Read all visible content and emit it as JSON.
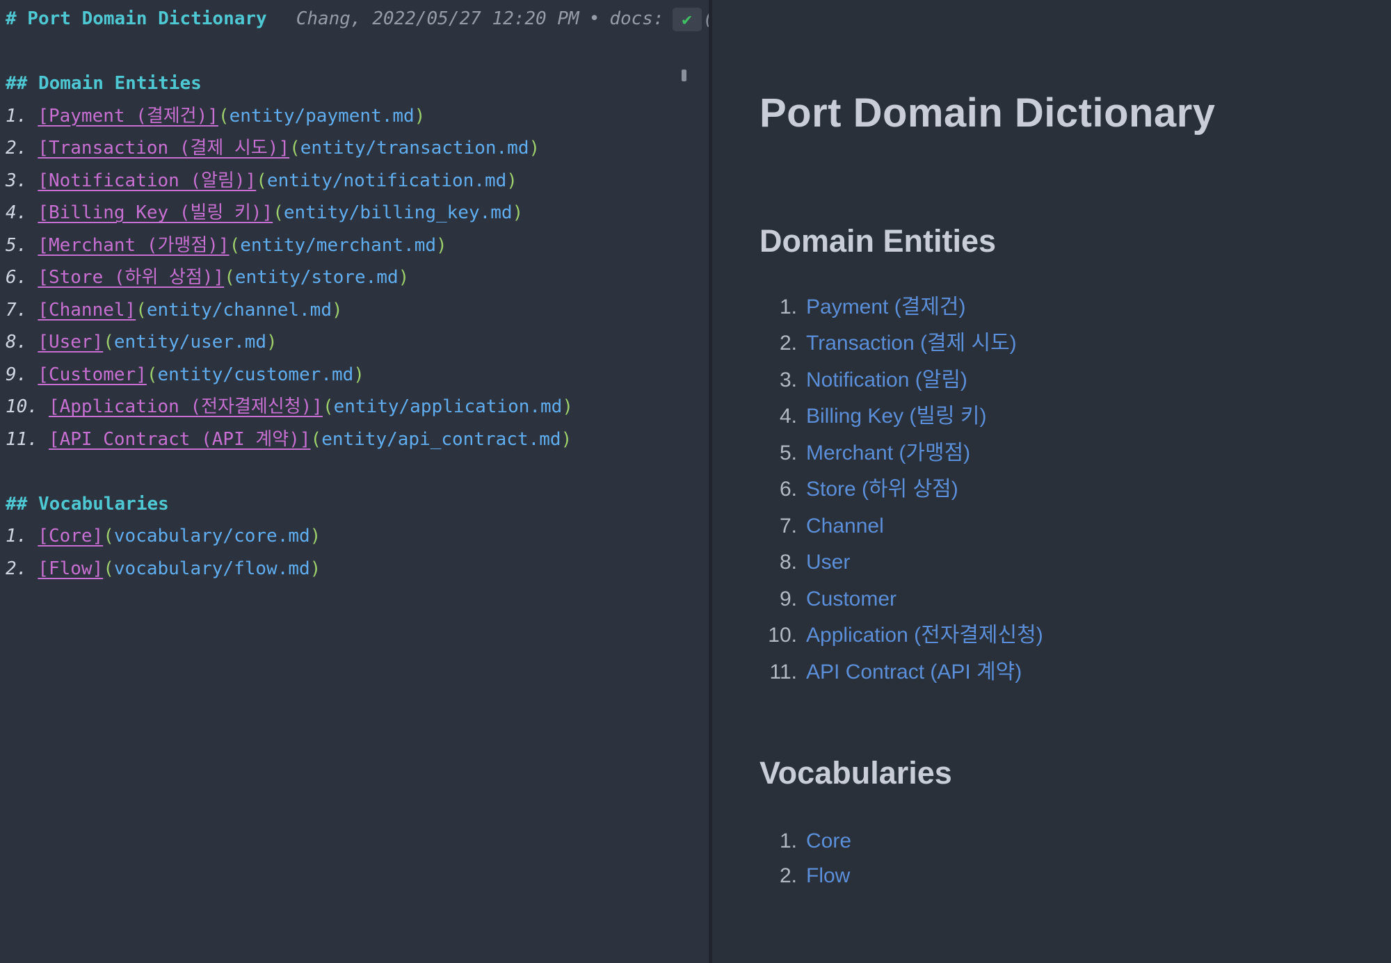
{
  "syntax": {
    "open_paren": "(",
    "close_paren": ")"
  },
  "colors": {
    "editor_background": "#2c323e",
    "preview_background": "#293039",
    "heading_cyan": "#4ec9d4",
    "link_magenta": "#c86fd2",
    "url_blue": "#60aeef",
    "paren_green": "#9ed06c",
    "preview_link_blue": "#5b8fda",
    "check_green": "#3fc163"
  },
  "editor": {
    "title_heading": "# Port Domain Dictionary",
    "blame_author_date": "Chang, 2022/05/27 12:20 PM",
    "blame_separator": "•",
    "blame_message_prefix": "docs:",
    "blame_check": "✔",
    "blame_truncated": "(",
    "entities_heading": "## Domain Entities",
    "entities": [
      {
        "num": "1.",
        "label": "[Payment (결제건)]",
        "url": "entity/payment.md"
      },
      {
        "num": "2.",
        "label": "[Transaction (결제 시도)]",
        "url": "entity/transaction.md"
      },
      {
        "num": "3.",
        "label": "[Notification (알림)]",
        "url": "entity/notification.md"
      },
      {
        "num": "4.",
        "label": "[Billing Key (빌링 키)]",
        "url": "entity/billing_key.md"
      },
      {
        "num": "5.",
        "label": "[Merchant (가맹점)]",
        "url": "entity/merchant.md"
      },
      {
        "num": "6.",
        "label": "[Store (하위 상점)]",
        "url": "entity/store.md"
      },
      {
        "num": "7.",
        "label": "[Channel]",
        "url": "entity/channel.md"
      },
      {
        "num": "8.",
        "label": "[User]",
        "url": "entity/user.md"
      },
      {
        "num": "9.",
        "label": "[Customer]",
        "url": "entity/customer.md"
      },
      {
        "num": "10.",
        "label": "[Application (전자결제신청)]",
        "url": "entity/application.md"
      },
      {
        "num": "11.",
        "label": "[API Contract (API 계약)]",
        "url": "entity/api_contract.md"
      }
    ],
    "vocab_heading": "## Vocabularies",
    "vocabularies": [
      {
        "num": "1.",
        "label": "[Core]",
        "url": "vocabulary/core.md"
      },
      {
        "num": "2.",
        "label": "[Flow]",
        "url": "vocabulary/flow.md"
      }
    ]
  },
  "preview": {
    "title": "Port Domain Dictionary",
    "entities_heading": "Domain Entities",
    "entities": [
      {
        "num": "1.",
        "text": "Payment (결제건)"
      },
      {
        "num": "2.",
        "text": "Transaction (결제 시도)"
      },
      {
        "num": "3.",
        "text": "Notification (알림)"
      },
      {
        "num": "4.",
        "text": "Billing Key (빌링 키)"
      },
      {
        "num": "5.",
        "text": "Merchant (가맹점)"
      },
      {
        "num": "6.",
        "text": "Store (하위 상점)"
      },
      {
        "num": "7.",
        "text": "Channel"
      },
      {
        "num": "8.",
        "text": "User"
      },
      {
        "num": "9.",
        "text": "Customer"
      },
      {
        "num": "10.",
        "text": "Application (전자결제신청)"
      },
      {
        "num": "11.",
        "text": "API Contract (API 계약)"
      }
    ],
    "vocab_heading": "Vocabularies",
    "vocabularies": [
      {
        "num": "1.",
        "text": "Core"
      },
      {
        "num": "2.",
        "text": "Flow"
      }
    ]
  }
}
